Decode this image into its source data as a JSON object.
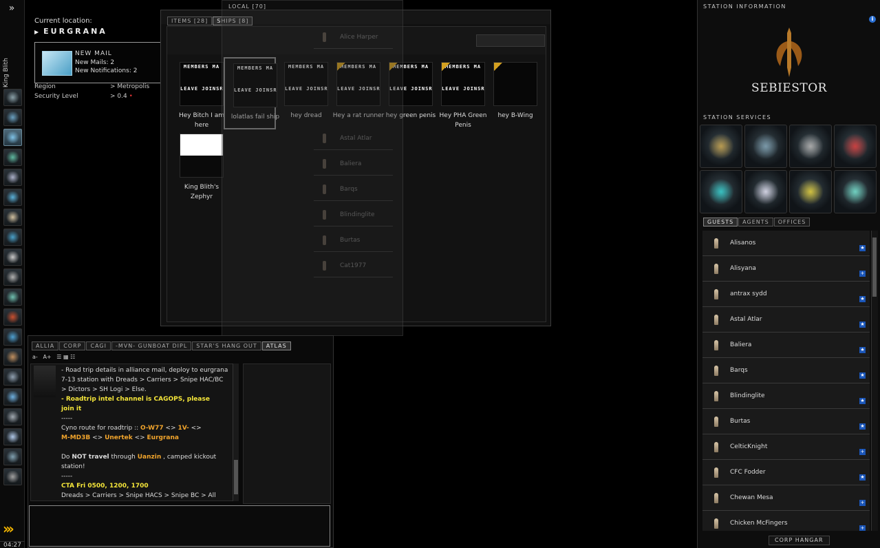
{
  "neocom": {
    "menu_icon": "»",
    "character_name": "King Blith",
    "clock": "04:27",
    "buttons": [
      "character-sheet-icon",
      "market-icon",
      "mail-icon",
      "fittings-icon",
      "assets-icon",
      "map-icon",
      "journal-icon",
      "corporation-icon",
      "star-map-icon",
      "item-box-icon",
      "science-icon",
      "ship-upgrade-icon",
      "browser-icon",
      "book-icon",
      "headset-icon",
      "people-icon",
      "medal-icon",
      "help-icon",
      "drone-icon",
      "industry-icon"
    ]
  },
  "location": {
    "label": "Current location:",
    "system": "EURGRANA",
    "region_label": "Region",
    "region_value": "> Metropolis",
    "security_label": "Security Level",
    "security_value": "> 0.4"
  },
  "mail_notice": {
    "title": "NEW MAIL",
    "new_mails": "New Mails: 2",
    "new_notifications": "New Notifications: 2",
    "close": "×"
  },
  "hangar": {
    "tabs": [
      "ITEMS [28]",
      "SHIPS [8]"
    ],
    "active_tab": 1,
    "banner_top": "MEMBERS MA",
    "banner_bottom": "LEAVE JOINSR",
    "ships": [
      {
        "name": "Hey Bitch I am here",
        "flag": false
      },
      {
        "name": "lolatlas fail ship",
        "flag": false
      },
      {
        "name": "hey dread",
        "flag": false
      },
      {
        "name": "Hey a rat runner",
        "flag": true
      },
      {
        "name": "hey green penis",
        "flag": true
      },
      {
        "name": "Hey PHA Green Penis",
        "flag": true
      },
      {
        "name": "hey B-Wing",
        "flag": true
      },
      {
        "name": "King Blith's Zephyr",
        "flag": false
      }
    ]
  },
  "local": {
    "title": "LOCAL [70]",
    "members": [
      "Alice Harper",
      "Astal Atlar",
      "Baliera",
      "Barqs",
      "Blindinglite",
      "Burtas",
      "Cat1977"
    ]
  },
  "chat": {
    "tabs": [
      "ALLIA",
      "CORP",
      "CAGI",
      "-MVN- GUNBOAT DIPL",
      "STAR'S HANG OUT",
      "ATLAS"
    ],
    "active_tab": 5,
    "font_minus": "a-",
    "font_plus": "A+",
    "lines": [
      {
        "parts": [
          {
            "t": "- Road trip details in alliance mail, deploy to eurgrana",
            "c": ""
          }
        ]
      },
      {
        "parts": [
          {
            "t": "7-13 station with Dreads > Carriers > Snipe HAC/BC",
            "c": ""
          }
        ]
      },
      {
        "parts": [
          {
            "t": "> Dictors > SH Logi > Else.",
            "c": ""
          }
        ]
      },
      {
        "parts": [
          {
            "t": "- Roadtrip intel channel is CAGOPS, please",
            "c": "y"
          }
        ]
      },
      {
        "parts": [
          {
            "t": "join it",
            "c": "y"
          }
        ]
      },
      {
        "parts": [
          {
            "t": "-----",
            "c": ""
          }
        ]
      },
      {
        "parts": [
          {
            "t": "Cyno route for roadtrip :: ",
            "c": ""
          },
          {
            "t": "O-W77",
            "c": "o"
          },
          {
            "t": " <> ",
            "c": ""
          },
          {
            "t": "1V-",
            "c": "o"
          },
          {
            "t": " <>",
            "c": ""
          }
        ]
      },
      {
        "parts": [
          {
            "t": "M-MD3B",
            "c": "o"
          },
          {
            "t": " <> ",
            "c": ""
          },
          {
            "t": "Unertek",
            "c": "o"
          },
          {
            "t": " <> ",
            "c": ""
          },
          {
            "t": "Eurgrana",
            "c": "o"
          }
        ]
      },
      {
        "parts": [
          {
            "t": "",
            "c": ""
          }
        ]
      },
      {
        "parts": [
          {
            "t": "Do ",
            "c": ""
          },
          {
            "t": "NOT travel",
            "c": "b"
          },
          {
            "t": " through ",
            "c": ""
          },
          {
            "t": "Uanzin",
            "c": "o"
          },
          {
            "t": " , camped kickout",
            "c": ""
          }
        ]
      },
      {
        "parts": [
          {
            "t": "station!",
            "c": ""
          }
        ]
      },
      {
        "parts": [
          {
            "t": "-----",
            "c": ""
          }
        ]
      },
      {
        "parts": [
          {
            "t": "CTA Fri 0500, 1200, 1700",
            "c": "y"
          }
        ]
      },
      {
        "parts": [
          {
            "t": "Dreads > Carriers > Snipe HACS > Snipe BC > All",
            "c": ""
          }
        ]
      }
    ]
  },
  "station": {
    "info_title": "STATION INFORMATION",
    "info_icon": "i",
    "corp_name": "SEBIESTOR",
    "services_title": "STATION SERVICES",
    "services": [
      "bounty-office-icon",
      "fitting-service-icon",
      "security-office-icon",
      "agents-icon",
      "reprocessing-icon",
      "insurance-icon",
      "recycle-icon",
      "medical-icon"
    ],
    "tabs": [
      "GUESTS",
      "AGENTS",
      "OFFICES"
    ],
    "active_tab": 0,
    "guests": [
      {
        "name": "Alisanos",
        "std": "★"
      },
      {
        "name": "Alisyana",
        "std": "+"
      },
      {
        "name": "antrax sydd",
        "std": "★"
      },
      {
        "name": "Astal Atlar",
        "std": "★"
      },
      {
        "name": "Baliera",
        "std": "★"
      },
      {
        "name": "Barqs",
        "std": "★"
      },
      {
        "name": "Blindinglite",
        "std": "★"
      },
      {
        "name": "Burtas",
        "std": "★"
      },
      {
        "name": "CelticKnight",
        "std": "+"
      },
      {
        "name": "CFC Fodder",
        "std": "★"
      },
      {
        "name": "Chewan Mesa",
        "std": "+"
      },
      {
        "name": "Chicken McFingers",
        "std": "+"
      }
    ],
    "corp_hangar": "CORP HANGAR"
  }
}
